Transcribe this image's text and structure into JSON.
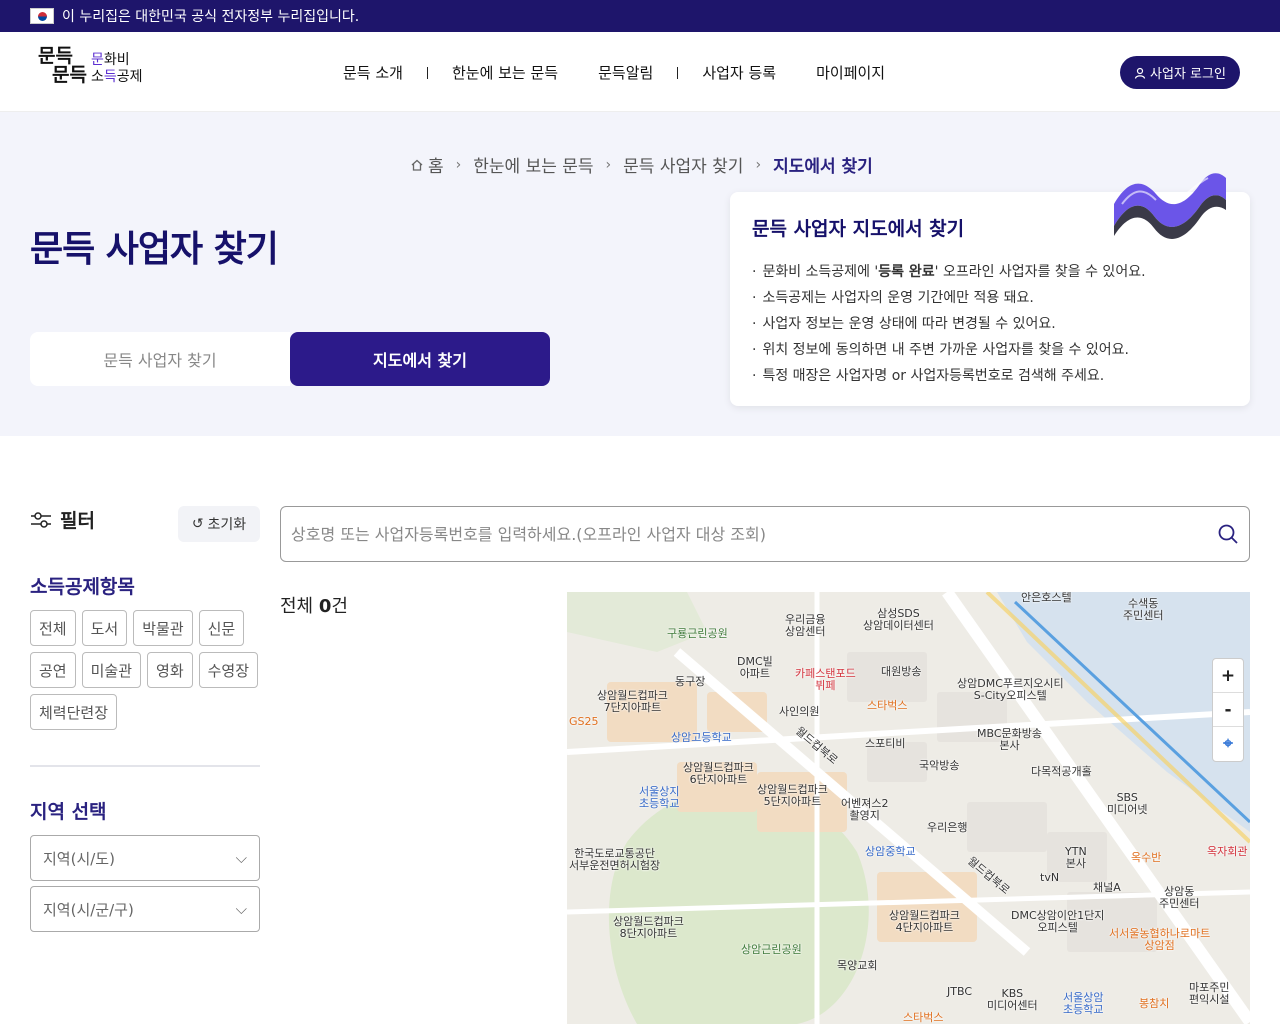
{
  "gov_banner": {
    "text": "이 누리집은 대한민국 공식 전자정부 누리집입니다."
  },
  "logo": {
    "hand_1": "문득",
    "hand_2": "문득",
    "sub_1_p": "문",
    "sub_1": "화비",
    "sub_2a": "소",
    "sub_2_p": "득",
    "sub_2b": "공제"
  },
  "nav": {
    "items": [
      "문득 소개",
      "한눈에 보는 문득",
      "문득알림",
      "사업자 등록",
      "마이페이지"
    ]
  },
  "login": {
    "label": "사업자 로그인"
  },
  "breadcrumb": {
    "home": "홈",
    "items": [
      "한눈에 보는 문득",
      "문득 사업자 찾기",
      "지도에서 찾기"
    ]
  },
  "hero": {
    "title": "문득 사업자 찾기",
    "tab_list": "문득 사업자 찾기",
    "tab_map": "지도에서 찾기"
  },
  "info": {
    "title": "문득 사업자 지도에서 찾기",
    "line1_a": "문화비 소득공제에 '",
    "line1_b": "등록 완료",
    "line1_c": "' 오프라인 사업자를 찾을 수 있어요.",
    "items": [
      "소득공제는 사업자의 운영 기간에만 적용 돼요.",
      "사업자 정보는 운영 상태에 따라 변경될 수 있어요.",
      "위치 정보에 동의하면 내 주변 가까운 사업자를 찾을 수 있어요.",
      "특정 매장은 사업자명 or 사업자등록번호로 검색해 주세요."
    ]
  },
  "filter": {
    "title": "필터",
    "reset": "초기화",
    "category_title": "소득공제항목",
    "categories": [
      "전체",
      "도서",
      "박물관",
      "신문",
      "공연",
      "미술관",
      "영화",
      "수영장",
      "체력단련장"
    ],
    "region_title": "지역 선택",
    "region_sido": "지역(시/도)",
    "region_sigungu": "지역(시/군/구)"
  },
  "search": {
    "placeholder": "상호명 또는 사업자등록번호를 입력하세요.(오프라인 사업자 대상 조회)"
  },
  "result": {
    "prefix": "전체 ",
    "count": "0",
    "suffix": "건"
  },
  "map": {
    "zoom_in": "+",
    "zoom_out": "-",
    "labels": {
      "l1": "구룡근린공원",
      "l2": "우리금융\n상암센터",
      "l3": "삼성SDS\n상암데이터센터",
      "l4": "안은호스텔",
      "l5": "수색동\n주민센터",
      "l6": "DMC빌\n아파트",
      "l7": "카페스탠포드\n뷔페",
      "l8": "대원방송",
      "l9": "상암월드컵파크\n7단지아파트",
      "l10": "사인의원",
      "l11": "스타벅스",
      "l12": "상암DMC푸르지오시티\nS-City오피스텔",
      "l13": "상암고등학교",
      "l14": "스포티비",
      "l15": "MBC문화방송\n본사",
      "l16": "국악방송",
      "l17": "상암월드컵파크\n6단지아파트",
      "l18": "다목적공개홀",
      "l19": "서울상지\n초등학교",
      "l20": "상암월드컵파크\n5단지아파트",
      "l21": "어벤져스2\n촬영지",
      "l22": "SBS\n미디어넷",
      "l23": "우리은행",
      "l24": "한국도로교통공단\n서부운전면허시험장",
      "l25": "상암중학교",
      "l26": "YTN\n본사",
      "l27": "옥수반",
      "l28": "tvN",
      "l29": "채널A",
      "l30": "상암동\n주민센터",
      "l31": "상암월드컵파크\n8단지아파트",
      "l32": "상암월드컵파크\n4단지아파트",
      "l33": "DMC상암이안1단지\n오피스텔",
      "l34": "서서울농협하나로마트\n상암점",
      "l35": "상암근린공원",
      "l36": "목양교회",
      "l37": "JTBC",
      "l38": "KBS\n미디어센터",
      "l39": "서울상암\n초등학교",
      "l40": "봉참치",
      "l41": "마포주민\n편익시설",
      "l42": "월드컵북로",
      "l43": "월드컵북로",
      "l44": "GS25",
      "l45": "동구장",
      "l46": "옥자회관",
      "l47": "스타벅스"
    }
  }
}
